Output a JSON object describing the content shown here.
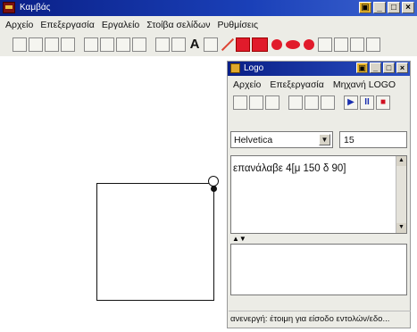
{
  "app": {
    "title": "Καμβάς",
    "window_buttons": [
      "▣",
      "_",
      "□",
      "×"
    ]
  },
  "menubar": {
    "items": [
      "Αρχείο",
      "Επεξεργασία",
      "Εργαλείο",
      "Στοίβα σελίδων",
      "Ρυθμίσεις"
    ]
  },
  "toolbar": {
    "text_tool": "A"
  },
  "logo_window": {
    "title": "Logo",
    "window_buttons": [
      "▣",
      "_",
      "□",
      "×"
    ],
    "menu": [
      "Αρχείο",
      "Επεξεργασία",
      "Μηχανή LOGO"
    ],
    "toolbar": {
      "play": "▶",
      "pause": "II",
      "stop": "■"
    },
    "font": {
      "family": "Helvetica",
      "size": "15"
    },
    "editor_code": "επανάλαβε 4[μ 150 δ 90]",
    "splitter_arrows": "▲▼",
    "status": "ανενεργή: έτοιμη για είσοδο εντολών/εδο..."
  },
  "colors": {
    "title_bar": "#0a1f86",
    "palette_red": "#e11b2b"
  }
}
